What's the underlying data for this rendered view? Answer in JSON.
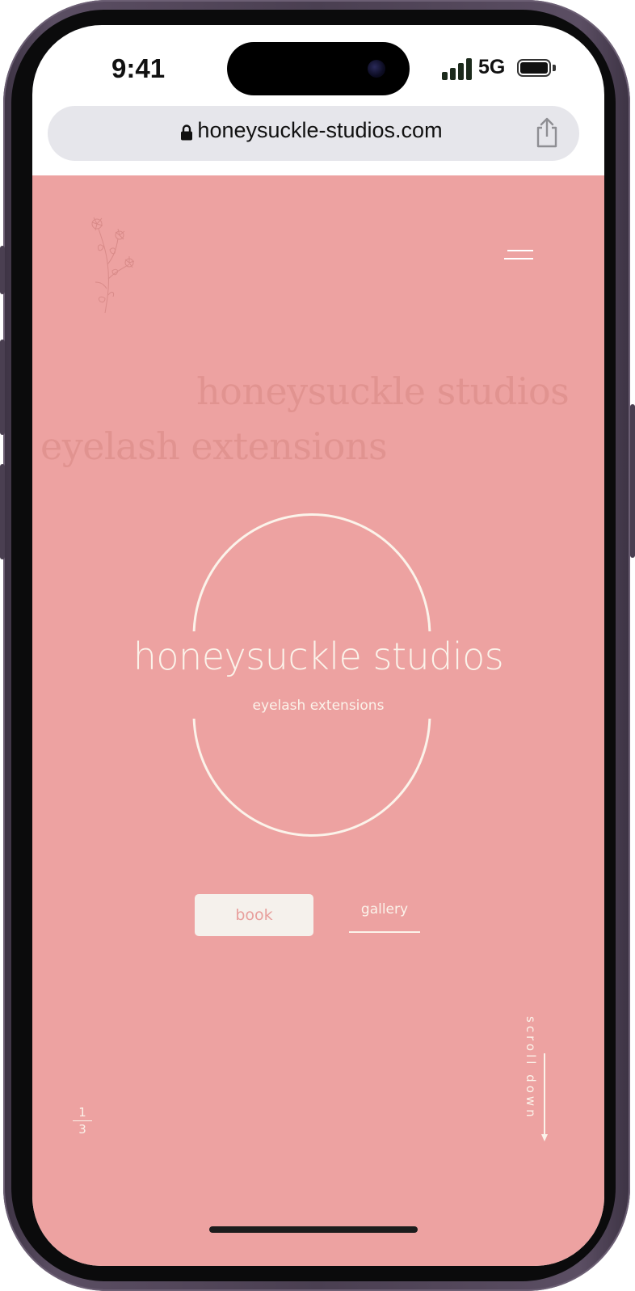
{
  "status_bar": {
    "time": "9:41",
    "network": "5G",
    "signal_bars": 4,
    "battery_level": 1.0
  },
  "browser": {
    "url": "honeysuckle-studios.com",
    "lock_icon": "lock-icon",
    "share_icon": "share-icon"
  },
  "site": {
    "background_color": "#eda2a1",
    "accent_color": "#fbf3ea",
    "logo_icon": "flower-sprig-icon",
    "menu_icon": "hamburger-menu-icon",
    "bg_title": "honeysuckle studios",
    "bg_subtitle": "eyelash extensions",
    "brand_name": "honeysuckle studios",
    "brand_tagline": "eyelash extensions",
    "book_label": "book",
    "gallery_label": "gallery",
    "scroll_label": "scroll down",
    "page_current": "1",
    "page_total": "3"
  }
}
